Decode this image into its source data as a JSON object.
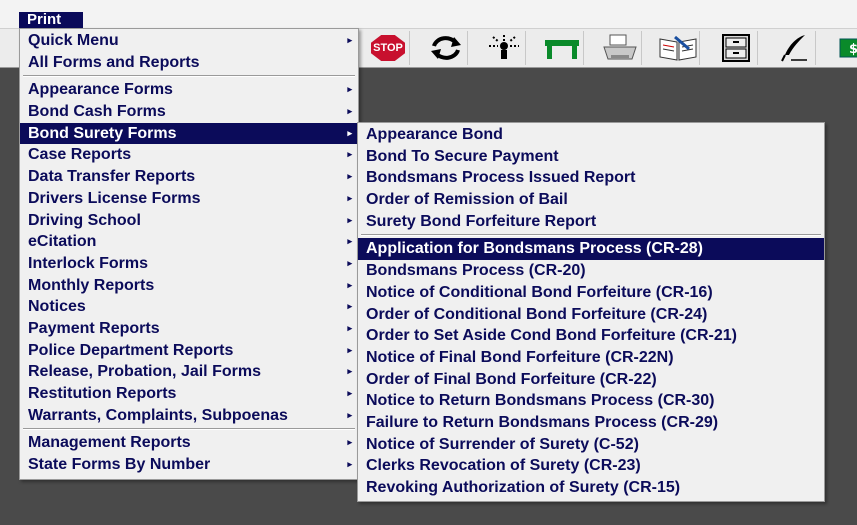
{
  "menubar": {
    "title": "Print"
  },
  "toolbar": {
    "buttons": [
      {
        "icon": "stop-sign-icon",
        "label": "STOP"
      },
      {
        "icon": "refresh-icon"
      },
      {
        "icon": "network-icon"
      },
      {
        "icon": "table-icon"
      },
      {
        "icon": "printer-icon"
      },
      {
        "icon": "book-icon"
      },
      {
        "icon": "cabinet-icon"
      },
      {
        "icon": "quill-pen-icon"
      },
      {
        "icon": "dollar-icon"
      }
    ]
  },
  "print_menu": {
    "group1": [
      {
        "label": "Quick Menu",
        "submenu": true
      },
      {
        "label": "All Forms and Reports",
        "submenu": false
      }
    ],
    "group2": [
      {
        "label": "Appearance Forms",
        "submenu": true
      },
      {
        "label": "Bond Cash Forms",
        "submenu": true
      },
      {
        "label": "Bond Surety Forms",
        "submenu": true,
        "active": true
      },
      {
        "label": "Case Reports",
        "submenu": true
      },
      {
        "label": "Data Transfer Reports",
        "submenu": true
      },
      {
        "label": "Drivers License Forms",
        "submenu": true
      },
      {
        "label": "Driving School",
        "submenu": true
      },
      {
        "label": "eCitation",
        "submenu": true
      },
      {
        "label": "Interlock Forms",
        "submenu": true
      },
      {
        "label": "Monthly Reports",
        "submenu": true
      },
      {
        "label": "Notices",
        "submenu": true
      },
      {
        "label": "Payment Reports",
        "submenu": true
      },
      {
        "label": "Police Department Reports",
        "submenu": true
      },
      {
        "label": "Release, Probation, Jail Forms",
        "submenu": true
      },
      {
        "label": "Restitution Reports",
        "submenu": true
      },
      {
        "label": "Warrants, Complaints, Subpoenas",
        "submenu": true
      }
    ],
    "group3": [
      {
        "label": "Management Reports",
        "submenu": true
      },
      {
        "label": "State Forms By Number",
        "submenu": true
      }
    ]
  },
  "bond_surety_submenu": {
    "group1": [
      "Appearance Bond",
      "Bond To Secure Payment",
      "Bondsmans Process Issued Report",
      "Order of Remission of Bail",
      "Surety Bond Forfeiture Report"
    ],
    "group2": [
      "Application for Bondsmans Process (CR-28)",
      "Bondsmans Process (CR-20)",
      "Notice of Conditional Bond Forfeiture (CR-16)",
      "Order of Conditional Bond Forfeiture (CR-24)",
      "Order to Set Aside Cond Bond Forfeiture (CR-21)",
      "Notice of Final Bond Forfeiture (CR-22N)",
      "Order of Final Bond Forfeiture (CR-22)",
      "Notice to Return Bondsmans Process (CR-30)",
      "Failure to Return Bondsmans Process (CR-29)",
      "Notice of Surrender of Surety (C-52)",
      "Clerks Revocation of Surety (CR-23)",
      "Revoking Authorization of Surety (CR-15)"
    ],
    "highlighted": "Application for Bondsmans Process (CR-28)"
  },
  "colors": {
    "menu_text": "#0b0b5a",
    "highlight_bg": "#0b0b5a",
    "menu_bg": "#f0f0f0",
    "desktop_bg": "#4a4a4a"
  }
}
